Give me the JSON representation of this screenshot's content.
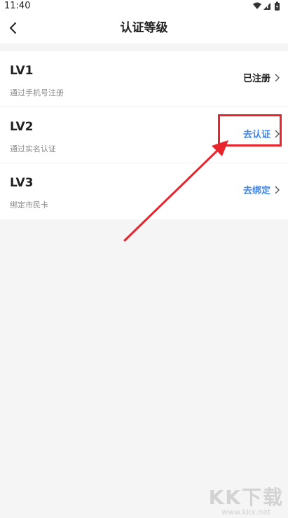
{
  "status_bar": {
    "time": "11:40"
  },
  "nav": {
    "title": "认证等级"
  },
  "levels": [
    {
      "level": "LV1",
      "description": "通过手机号注册",
      "action": "已注册",
      "state": "done"
    },
    {
      "level": "LV2",
      "description": "通过实名认证",
      "action": "去认证",
      "state": "todo"
    },
    {
      "level": "LV3",
      "description": "绑定市民卡",
      "action": "去绑定",
      "state": "todo"
    }
  ],
  "watermark": {
    "logo": "KK下载",
    "url": "www.kkx.net"
  },
  "colors": {
    "accent": "#3b86f2",
    "annotation": "#e8242d",
    "background": "#f5f5f5"
  },
  "icons": [
    "wifi-icon",
    "signal-icon",
    "battery-icon",
    "back-arrow-icon",
    "chevron-right-icon"
  ]
}
